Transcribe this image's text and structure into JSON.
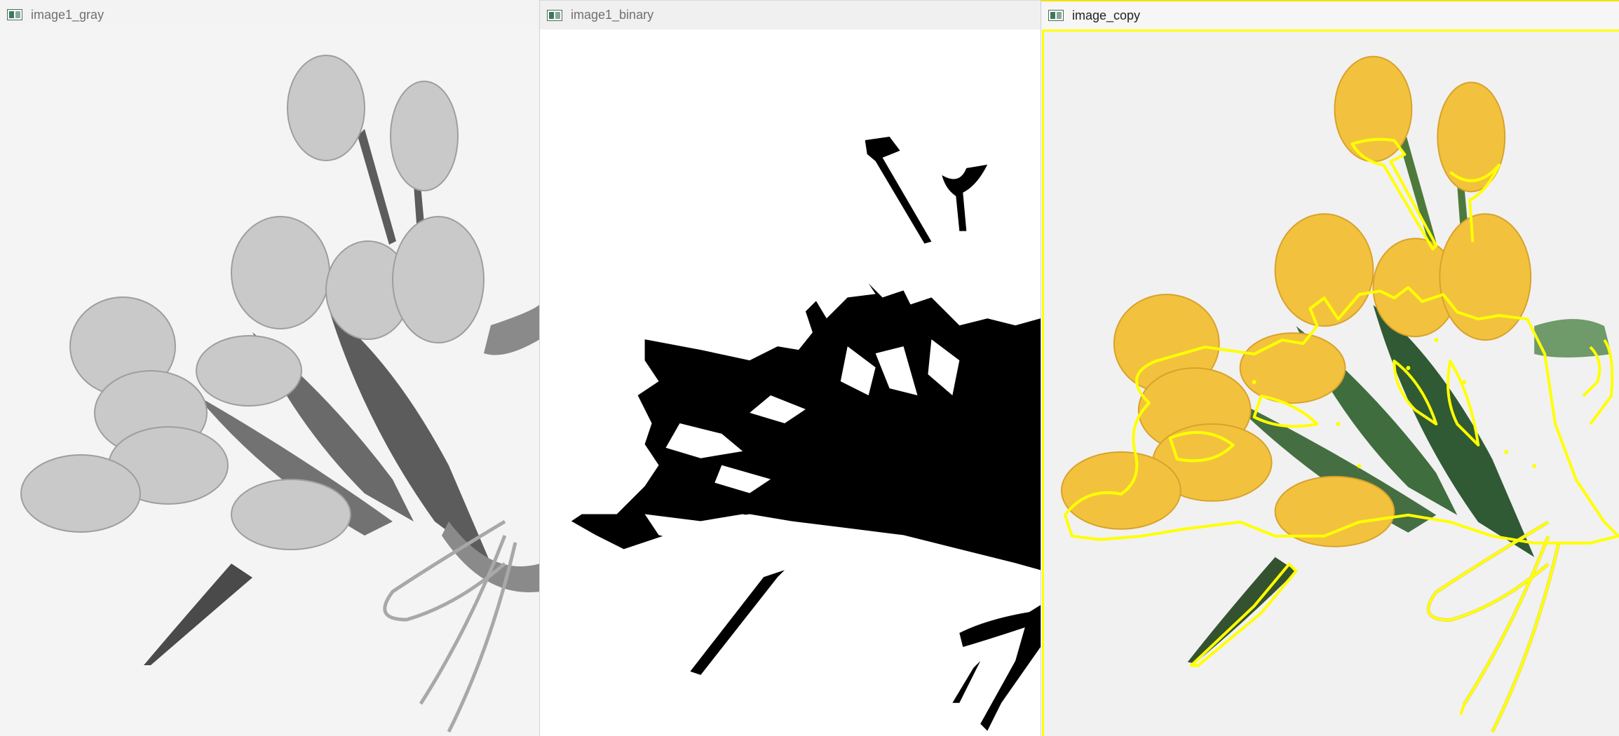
{
  "windows": {
    "gray": {
      "title": "image1_gray",
      "icon": "opencv-window-icon"
    },
    "binary": {
      "title": "image1_binary",
      "icon": "opencv-window-icon"
    },
    "copy": {
      "title": "image_copy",
      "icon": "opencv-window-icon"
    }
  },
  "colors": {
    "contour": "#ffff00",
    "tulip_yellow": "#f2c23f",
    "leaf_green": "#3f6a3d",
    "gray_background": "#f4f4f4",
    "binary_foreground": "#000000"
  }
}
